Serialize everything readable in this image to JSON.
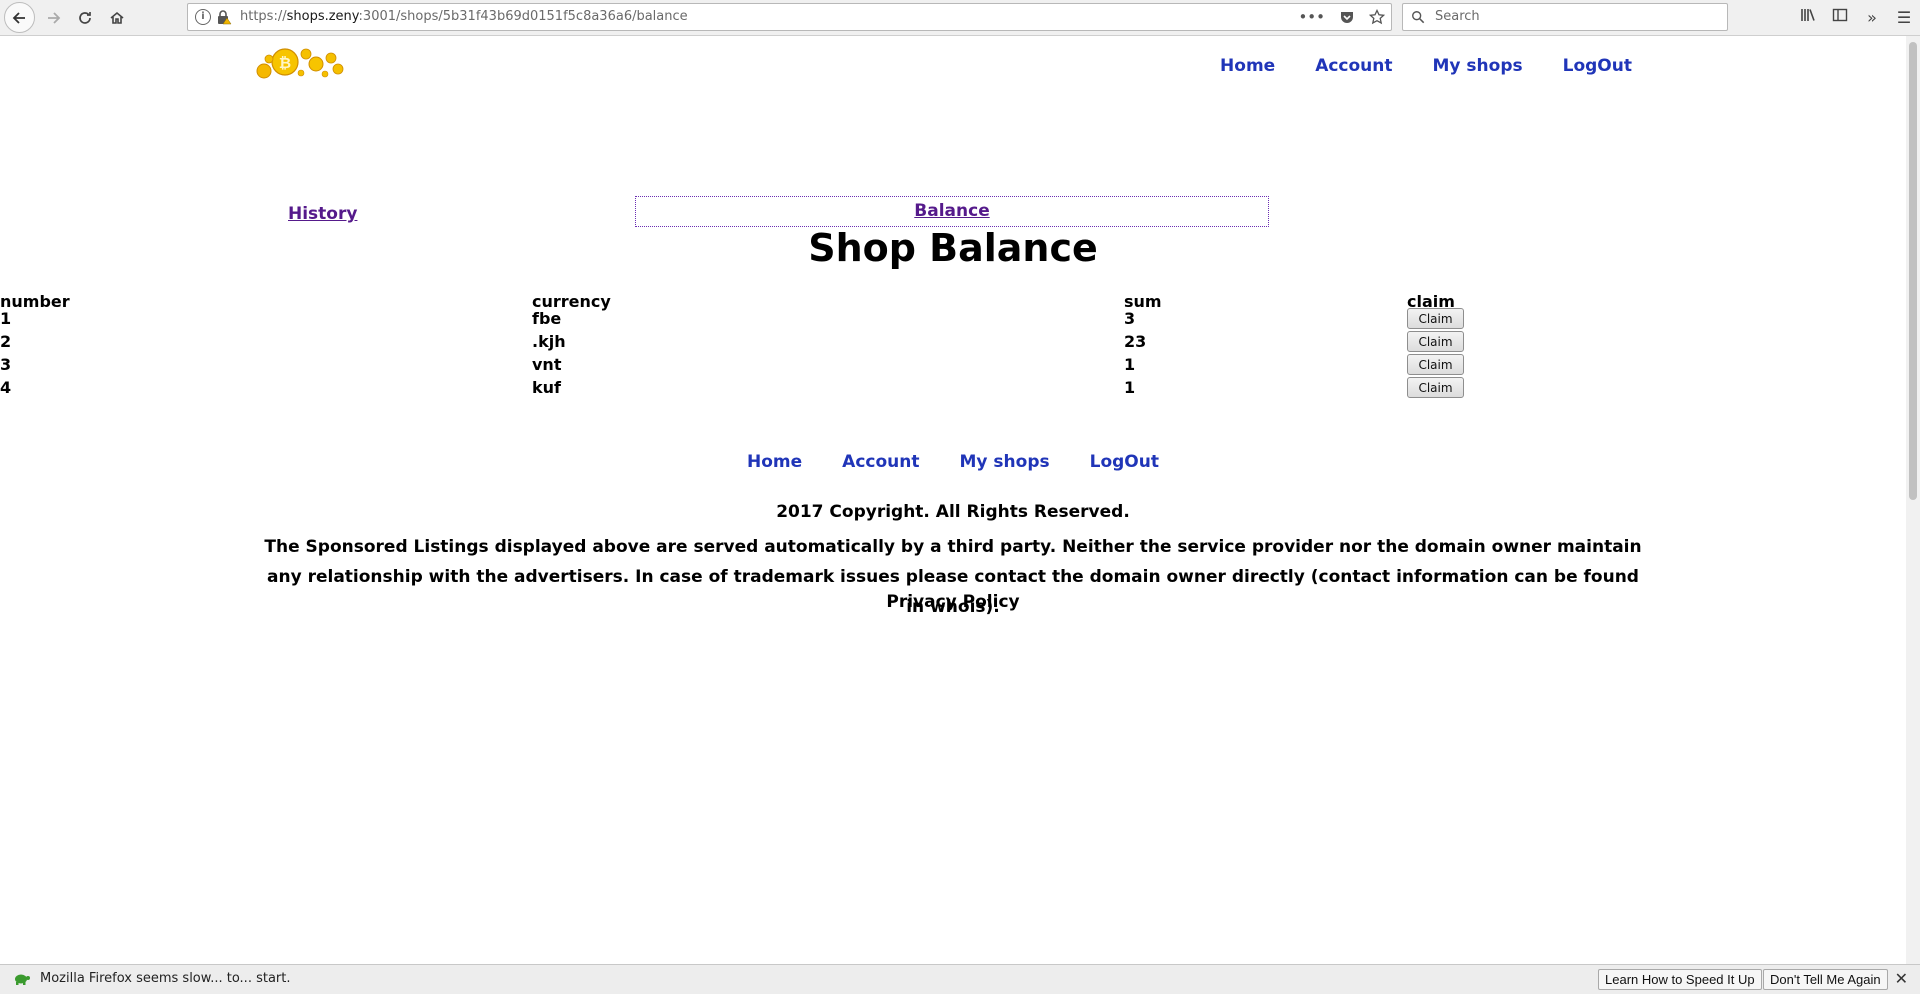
{
  "browser": {
    "url_scheme": "https://",
    "url_domain": "shops.zeny",
    "url_rest": ":3001/shops/5b31f43b69d0151f5c8a36a6/balance",
    "search_placeholder": "Search",
    "page_actions_icon": "ellipsis-icon"
  },
  "nav": {
    "home": "Home",
    "account": "Account",
    "my_shops": "My shops",
    "logout": "LogOut"
  },
  "tabs": {
    "history": "History",
    "balance": "Balance"
  },
  "page_title": "Shop Balance",
  "table": {
    "headers": [
      "number",
      "currency",
      "sum",
      "claim"
    ],
    "rows": [
      {
        "number": "1",
        "currency": "fbe",
        "sum": "3",
        "claim": "Claim"
      },
      {
        "number": "2",
        "currency": ".kjh",
        "sum": "23",
        "claim": "Claim"
      },
      {
        "number": "3",
        "currency": "vnt",
        "sum": "1",
        "claim": "Claim"
      },
      {
        "number": "4",
        "currency": "kuf",
        "sum": "1",
        "claim": "Claim"
      }
    ]
  },
  "footer": {
    "copyright": "2017 Copyright. All Rights Reserved.",
    "disclaimer": "The Sponsored Listings displayed above are served automatically by a third party. Neither the service provider nor the domain owner maintain any relationship with the advertisers. In case of trademark issues please contact the domain owner directly (contact information can be found in whois).",
    "privacy": "Privacy Policy"
  },
  "notification": {
    "message": "Mozilla Firefox seems slow... to... start.",
    "learn_button": "Learn How to Speed It Up",
    "dismiss_button": "Don't Tell Me Again"
  },
  "colors": {
    "nav_link": "#2035b8",
    "visited_link": "#551a8b",
    "logo_coin": "#f5b800"
  }
}
